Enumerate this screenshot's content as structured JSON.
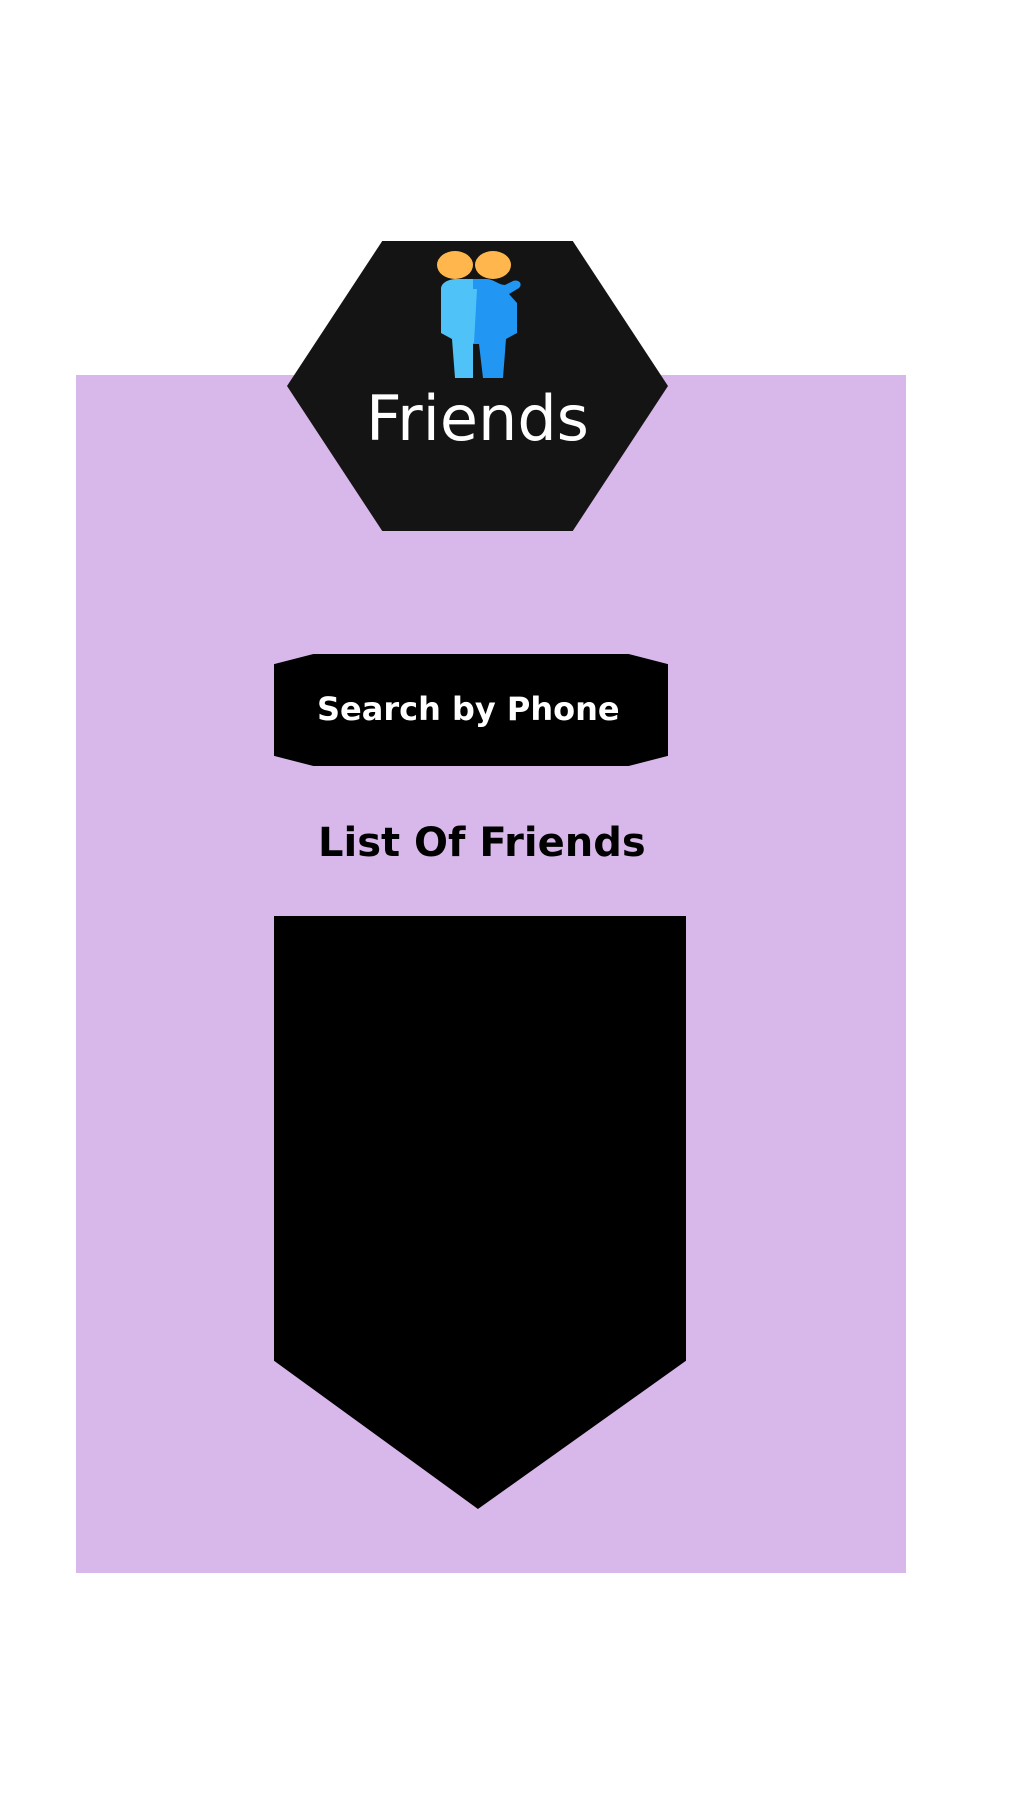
{
  "header": {
    "title": "Friends",
    "icon": "friends-icon"
  },
  "search": {
    "button_label": "Search by Phone"
  },
  "friends_list": {
    "title": "List Of Friends",
    "items": []
  },
  "colors": {
    "panel_background": "#d8b8ea",
    "header_background": "#141414",
    "button_background": "#000000",
    "list_background": "#000000",
    "icon_head": "#ffb74d",
    "icon_body_left": "#4fc3f7",
    "icon_body_right": "#2196f3"
  }
}
